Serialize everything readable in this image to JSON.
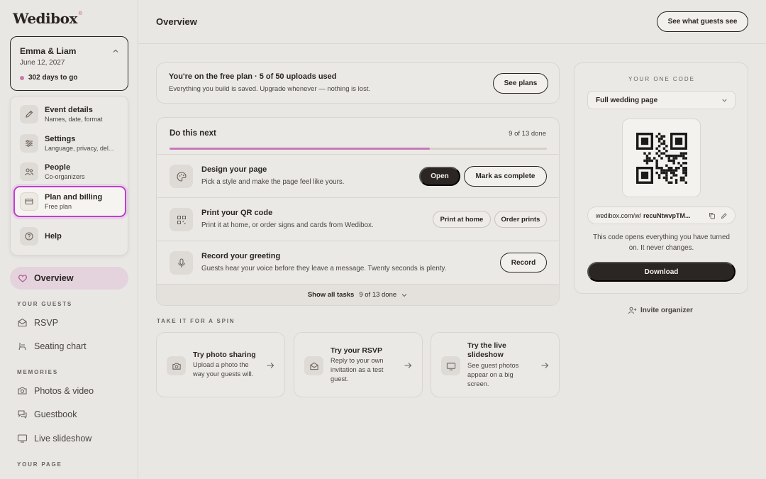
{
  "brand": {
    "name": "Wedibox",
    "mark": "®"
  },
  "event": {
    "names": "Emma & Liam",
    "date": "June 12, 2027",
    "countdown": "302 days to go"
  },
  "menu": [
    {
      "title": "Event details",
      "subtitle": "Names, date, format",
      "icon": "pen-icon"
    },
    {
      "title": "Settings",
      "subtitle": "Language, privacy, del...",
      "icon": "sliders-icon"
    },
    {
      "title": "People",
      "subtitle": "Co-organizers",
      "icon": "people-icon"
    },
    {
      "title": "Plan and billing",
      "subtitle": "Free plan",
      "icon": "card-icon"
    },
    {
      "title": "Help",
      "icon": "help-icon"
    }
  ],
  "nav": {
    "overview": "Overview",
    "sections": [
      "YOUR GUESTS",
      "MEMORIES",
      "YOUR PAGE"
    ],
    "guests": [
      "RSVP",
      "Seating chart"
    ],
    "memories": [
      "Photos & video",
      "Guestbook",
      "Live slideshow"
    ]
  },
  "header": {
    "title": "Overview",
    "guest_view": "See what guests see"
  },
  "plan": {
    "title": "You're on the free plan · 5 of 50 uploads used",
    "subtitle": "Everything you build is saved. Upgrade whenever — nothing is lost.",
    "button": "See plans"
  },
  "tasks": {
    "heading": "Do this next",
    "count": "9 of 13 done",
    "progress": 0.69,
    "items": [
      {
        "title": "Design your page",
        "subtitle": "Pick a style and make the page feel like yours.",
        "primary": "Open",
        "secondary": "Mark as complete"
      },
      {
        "title": "Print your QR code",
        "subtitle": "Print it at home, or order signs and cards from Wedibox.",
        "primary": "Print at home",
        "secondary": "Order prints"
      },
      {
        "title": "Record your greeting",
        "subtitle": "Guests hear your voice before they leave a message. Twenty seconds is plenty.",
        "primary": "Record"
      }
    ],
    "show_all": "Show all tasks",
    "show_all_count": "9 of 13 done"
  },
  "spin": {
    "heading": "TAKE IT FOR A SPIN",
    "items": [
      {
        "title": "Try photo sharing",
        "subtitle": "Upload a photo the way your guests will."
      },
      {
        "title": "Try your RSVP",
        "subtitle": "Reply to your own invitation as a test guest."
      },
      {
        "title": "Try the live slideshow",
        "subtitle": "See guest photos appear on a big screen."
      }
    ]
  },
  "code": {
    "label": "YOUR ONE CODE",
    "select": "Full wedding page",
    "url_prefix": "wedibox.com/w/",
    "url_code": "recuNtwvpTM...",
    "note": "This code opens everything you have turned on. It never changes.",
    "download": "Download",
    "invite": "Invite organizer"
  }
}
